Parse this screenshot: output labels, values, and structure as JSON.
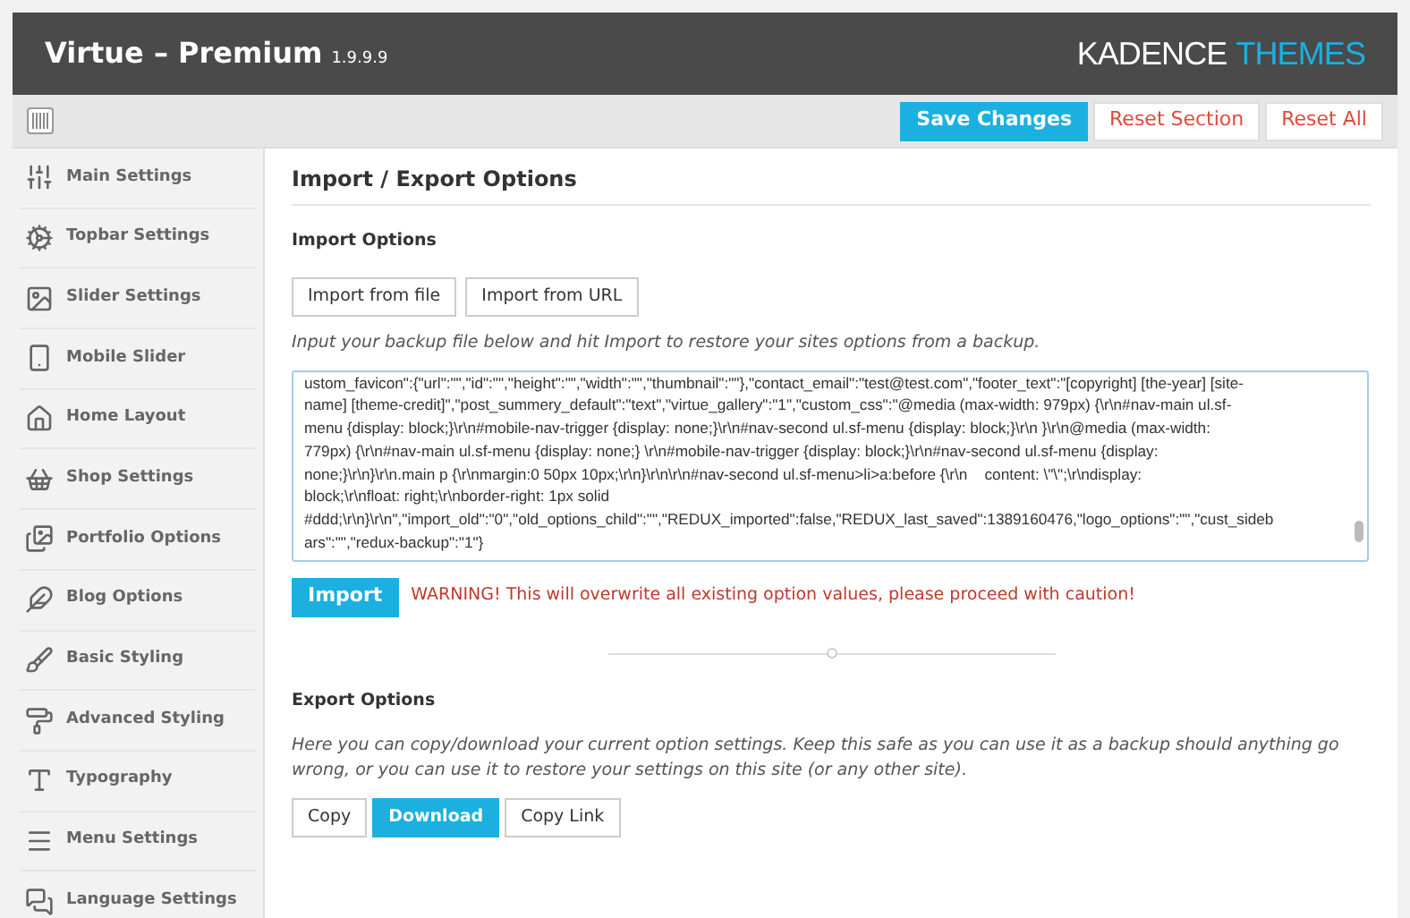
{
  "header": {
    "title": "Virtue – Premium",
    "version": "1.9.9.9",
    "logo_left": "KADENCE",
    "logo_right": "THEMES"
  },
  "toolbar": {
    "buttons": [
      {
        "label": "Save Changes",
        "kind": "primary"
      },
      {
        "label": "Reset Section",
        "kind": "danger"
      },
      {
        "label": "Reset All",
        "kind": "danger"
      }
    ]
  },
  "sidebar": {
    "items": [
      {
        "label": "Main Settings"
      },
      {
        "label": "Topbar Settings"
      },
      {
        "label": "Slider Settings"
      },
      {
        "label": "Mobile Slider"
      },
      {
        "label": "Home Layout"
      },
      {
        "label": "Shop Settings"
      },
      {
        "label": "Portfolio Options"
      },
      {
        "label": "Blog Options"
      },
      {
        "label": "Basic Styling"
      },
      {
        "label": "Advanced Styling"
      },
      {
        "label": "Typography"
      },
      {
        "label": "Menu Settings"
      },
      {
        "label": "Language Settings"
      }
    ]
  },
  "content": {
    "title": "Import / Export Options",
    "import": {
      "heading": "Import Options",
      "buttons": [
        {
          "label": "Import from file",
          "kind": "default"
        },
        {
          "label": "Import from URL",
          "kind": "default"
        }
      ],
      "hint": "Input your backup file below and hit Import to restore your sites options from a backup.",
      "textarea_lines": [
        "ustom_favicon\":{\"url\":\"\",\"id\":\"\",\"height\":\"\",\"width\":\"\",\"thumbnail\":\"\"},\"contact_email\":\"test@test.com\",\"footer_text\":\"[copyright] [the-year] [site-",
        "name] [theme-credit]\",\"post_summery_default\":\"text\",\"virtue_gallery\":\"1\",\"custom_css\":\"@media (max-width: 979px) {\\r\\n#nav-main ul.sf-",
        "menu {display: block;}\\r\\n#mobile-nav-trigger {display: none;}\\r\\n#nav-second ul.sf-menu {display: block;}\\r\\n }\\r\\n@media (max-width:",
        "779px) {\\r\\n#nav-main ul.sf-menu {display: none;} \\r\\n#mobile-nav-trigger {display: block;}\\r\\n#nav-second ul.sf-menu {display:",
        "none;}\\r\\n}\\r\\n.main p {\\r\\nmargin:0 50px 10px;\\r\\n}\\r\\n\\r\\n#nav-second ul.sf-menu>li>a:before {\\r\\n    content: \\\"\\\";\\r\\ndisplay:",
        "block;\\r\\nfloat: right;\\r\\nborder-right: 1px solid",
        "#ddd;\\r\\n}\\r\\n\",\"import_old\":\"0\",\"old_options_child\":\"\",\"REDUX_imported\":false,\"REDUX_last_saved\":1389160476,\"logo_options\":\"\",\"cust_sideb",
        "ars\":\"\",\"redux-backup\":\"1\"}"
      ],
      "import_button": {
        "label": "Import",
        "kind": "primary"
      },
      "warning": "WARNING! This will overwrite all existing option values, please proceed with caution!"
    },
    "export": {
      "heading": "Export Options",
      "description": "Here you can copy/download your current option settings. Keep this safe as you can use it as a backup should anything go wrong, or you can use it to restore your settings on this site (or any other site).",
      "buttons": [
        {
          "label": "Copy",
          "kind": "default"
        },
        {
          "label": "Download",
          "kind": "primary"
        },
        {
          "label": "Copy Link",
          "kind": "default"
        }
      ]
    }
  }
}
